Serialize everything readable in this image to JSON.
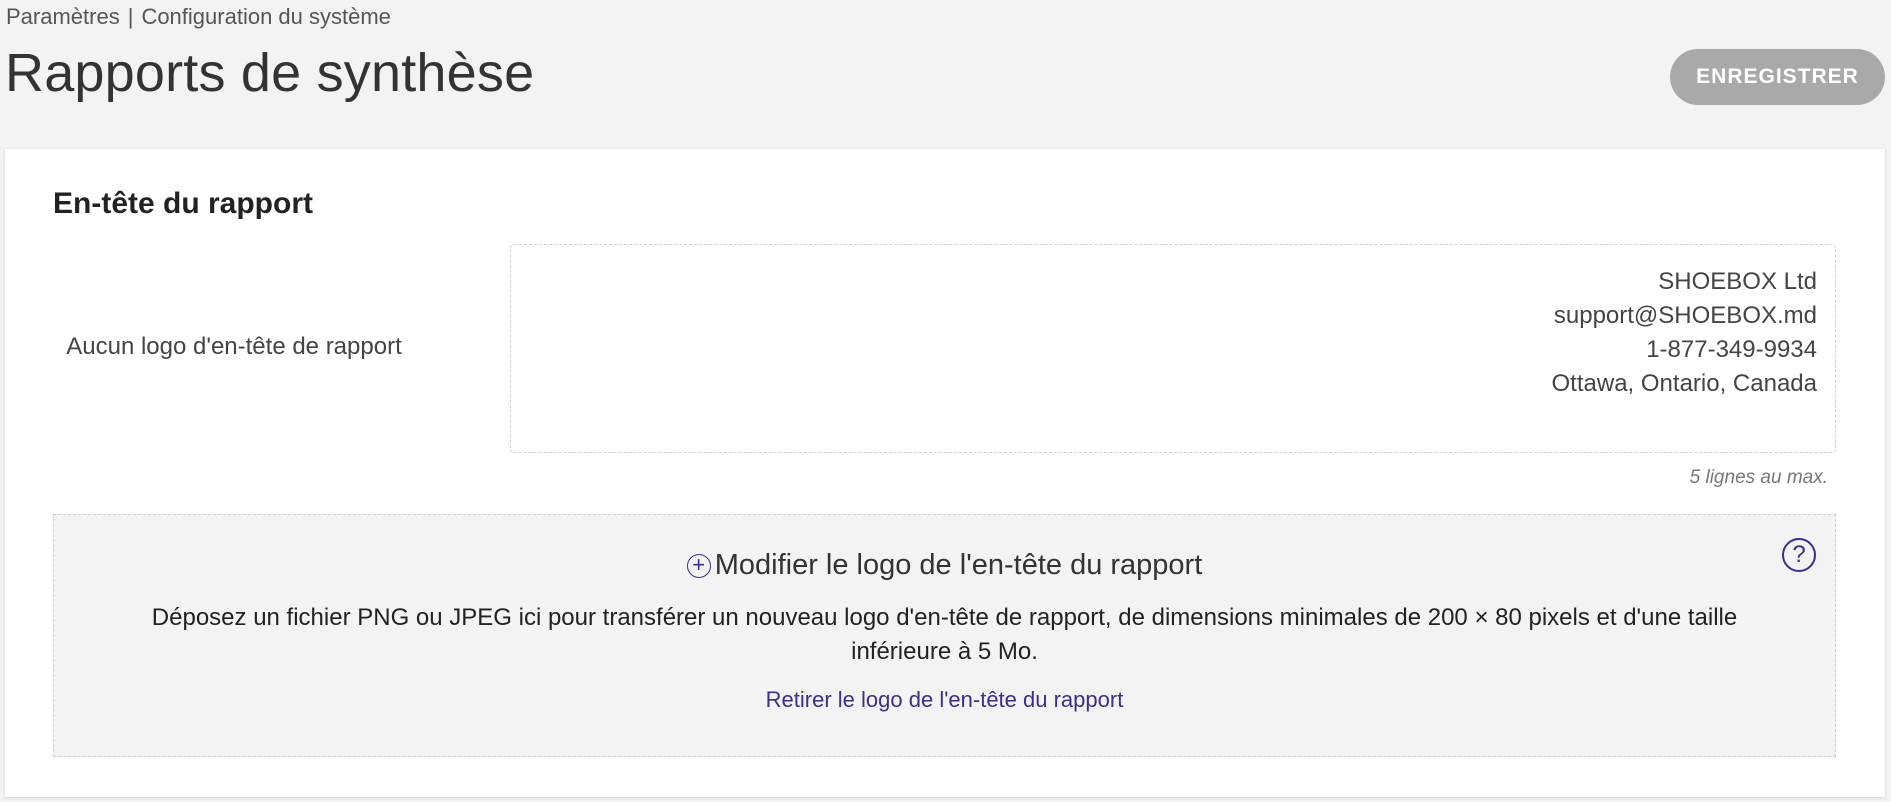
{
  "breadcrumb": {
    "parent": "Paramètres",
    "separator": "|",
    "current": "Configuration du système"
  },
  "page": {
    "title": "Rapports de synthèse",
    "save_label": "ENREGISTRER"
  },
  "report_header": {
    "section_title": "En-tête du rapport",
    "no_logo_text": "Aucun logo d'en-tête de rapport",
    "header_lines": [
      "SHOEBOX Ltd",
      "support@SHOEBOX.md",
      "1-877-349-9934",
      "Ottawa, Ontario, Canada"
    ],
    "max_lines_hint": "5 lignes au max."
  },
  "dropzone": {
    "plus_icon": "⊕",
    "title": "Modifier le logo de l'en-tête du rapport",
    "description": "Déposez un fichier PNG ou JPEG ici pour transférer un nouveau logo d'en-tête de rapport, de dimensions minimales de 200 × 80 pixels et d'une taille inférieure à 5 Mo.",
    "remove_link": "Retirer le logo de l'en-tête du rapport",
    "help_icon": "?"
  },
  "colors": {
    "accent": "#3b2f8a",
    "save_button_disabled": "#a9a9a9",
    "page_background": "#f3f3f3"
  }
}
